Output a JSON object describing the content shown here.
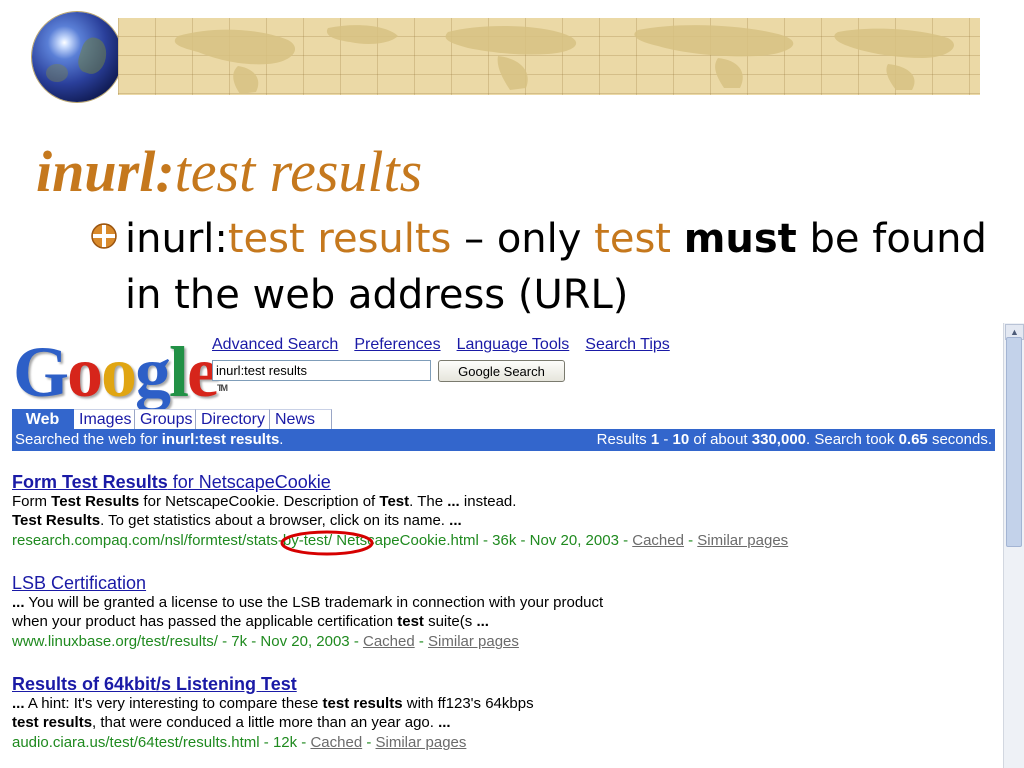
{
  "slide": {
    "title_bold": "inurl:",
    "title_rest": "test results",
    "bullet": {
      "part1": "inurl:",
      "part2": "test results",
      "part3": " – only ",
      "part4": "test",
      "part5": " ",
      "part6": "must",
      "part7": " be found in the web address (URL)"
    },
    "colors": {
      "accent": "#c5781d",
      "banner": "#ebd9a6"
    },
    "icons": [
      "globe-icon",
      "bullet-icon"
    ]
  },
  "google": {
    "logo": {
      "G": "G",
      "o1": "o",
      "o2": "o",
      "g": "g",
      "l": "l",
      "e": "e",
      "tm": "TM"
    },
    "top_links": [
      "Advanced Search",
      "Preferences",
      "Language Tools",
      "Search Tips"
    ],
    "search": {
      "value": "inurl:test results",
      "button": "Google Search"
    },
    "tabs": [
      "Web",
      "Images",
      "Groups",
      "Directory",
      "News"
    ],
    "active_tab": "Web",
    "status_bar": {
      "left_prefix": "Searched the web for ",
      "left_query": "inurl:test results",
      "left_suffix": ".",
      "r1": "Results ",
      "r2": "1",
      "r3": " - ",
      "r4": "10",
      "r5": " of about ",
      "r6": "330,000",
      "r7": ". Search took ",
      "r8": "0.65",
      "r9": " seconds."
    },
    "results": [
      {
        "title_a": "Form Test Results",
        "title_b": " for NetscapeCookie",
        "line1": [
          {
            "t": "Form ",
            "b": false
          },
          {
            "t": "Test Results",
            "b": true
          },
          {
            "t": " for NetscapeCookie. Description of ",
            "b": false
          },
          {
            "t": "Test",
            "b": true
          },
          {
            "t": ". The ",
            "b": false
          },
          {
            "t": "...",
            "b": true
          },
          {
            "t": " instead.",
            "b": false
          }
        ],
        "line2": [
          {
            "t": "Test Results",
            "b": true
          },
          {
            "t": ". To get statistics about a browser, click on its name. ",
            "b": false
          },
          {
            "t": "...",
            "b": true
          }
        ],
        "url": "research.compaq.com/nsl/formtest/stats-by-test/ NetscapeCookie.html - 36k - Nov 20, 2003 - ",
        "cached": "Cached",
        "sep": " - ",
        "similar": "Similar pages"
      },
      {
        "title_a": "LSB Certification",
        "title_b": "",
        "line1": [
          {
            "t": "...",
            "b": true
          },
          {
            "t": " You will be granted a license to use the LSB trademark in connection with your product",
            "b": false
          }
        ],
        "line2": [
          {
            "t": "when your product has passed the applicable certification ",
            "b": false
          },
          {
            "t": "test",
            "b": true
          },
          {
            "t": " suite(s ",
            "b": false
          },
          {
            "t": "...",
            "b": true
          }
        ],
        "url": "www.linuxbase.org/test/results/ - 7k - Nov 20, 2003 - ",
        "cached": "Cached",
        "sep": " - ",
        "similar": "Similar pages"
      },
      {
        "title_a": "Results of 64kbit/s Listening ",
        "title_b": "Test",
        "line1": [
          {
            "t": "...",
            "b": true
          },
          {
            "t": " A hint: It's very interesting to compare these ",
            "b": false
          },
          {
            "t": "test results",
            "b": true
          },
          {
            "t": " with ff123's 64kbps",
            "b": false
          }
        ],
        "line2": [
          {
            "t": "test results",
            "b": true
          },
          {
            "t": ", that were conduced a little more than an year ago. ",
            "b": false
          },
          {
            "t": "...",
            "b": true
          }
        ],
        "url": "audio.ciara.us/test/64test/results.html - 12k - ",
        "cached": "Cached",
        "sep": " - ",
        "similar": "Similar pages"
      }
    ],
    "annotation": "red-ellipse-highlight"
  }
}
